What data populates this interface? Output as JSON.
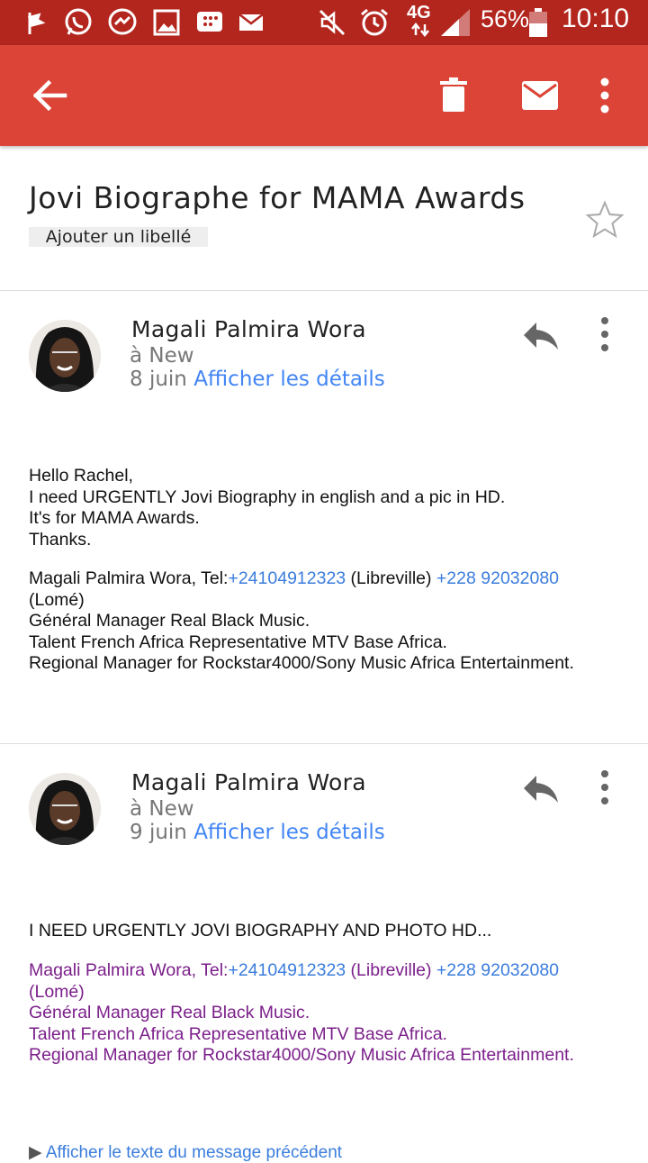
{
  "status_bar": {
    "icons": [
      "flag-icon",
      "whatsapp-icon",
      "messenger-icon",
      "gallery-icon",
      "bbm-icon",
      "gmail-icon",
      "mute-icon",
      "alarm-icon"
    ],
    "network": "4G",
    "battery": "56%",
    "time": "10:10"
  },
  "toolbar": {
    "back_icon": "arrow-left-icon",
    "delete_icon": "trash-icon",
    "mark_unread_icon": "envelope-icon",
    "overflow_icon": "more-vert-icon"
  },
  "subject": "Jovi Biographe for MAMA Awards",
  "label_button": "Ajouter un libellé",
  "messages": [
    {
      "sender": "Magali Palmira Wora",
      "to": "à New",
      "date": "8 juin",
      "details_link": "Afficher les détails",
      "body_lines": [
        "Hello Rachel,",
        "I need URGENTLY Jovi Biography in english and a pic in HD.",
        "It's for MAMA Awards.",
        "Thanks."
      ],
      "signature": {
        "prefix": "Magali Palmira Wora, Tel:",
        "phone1": "+24104912323",
        "mid": " (Libreville) ",
        "phone2": "+228 92032080",
        "suffix": "(Lomé)",
        "line2": "Général Manager Real Black Music.",
        "line3": "Talent French Africa Representative MTV Base Africa.",
        "line4": "Regional Manager for Rockstar4000/Sony Music Africa Entertainment."
      }
    },
    {
      "sender": "Magali Palmira Wora",
      "to": "à New",
      "date": "9 juin",
      "details_link": "Afficher les détails",
      "body_lines": [
        "I NEED URGENTLY JOVI BIOGRAPHY AND PHOTO HD..."
      ],
      "signature": {
        "prefix": "Magali Palmira Wora, Tel:",
        "phone1": "+24104912323",
        "mid": " (Libreville) ",
        "phone2": "+228 92032080",
        "suffix": "(Lomé)",
        "line2": "Général Manager Real Black Music.",
        "line3": "Talent French Africa Representative MTV Base Africa.",
        "line4": "Regional Manager for Rockstar4000/Sony Music Africa Entertainment."
      }
    }
  ],
  "footer_link": "Afficher le texte du message précédent",
  "colors": {
    "toolbar": "#db4437",
    "statusbar": "#b3261e",
    "link": "#4285f4",
    "quoted": "#7b1f8a"
  }
}
